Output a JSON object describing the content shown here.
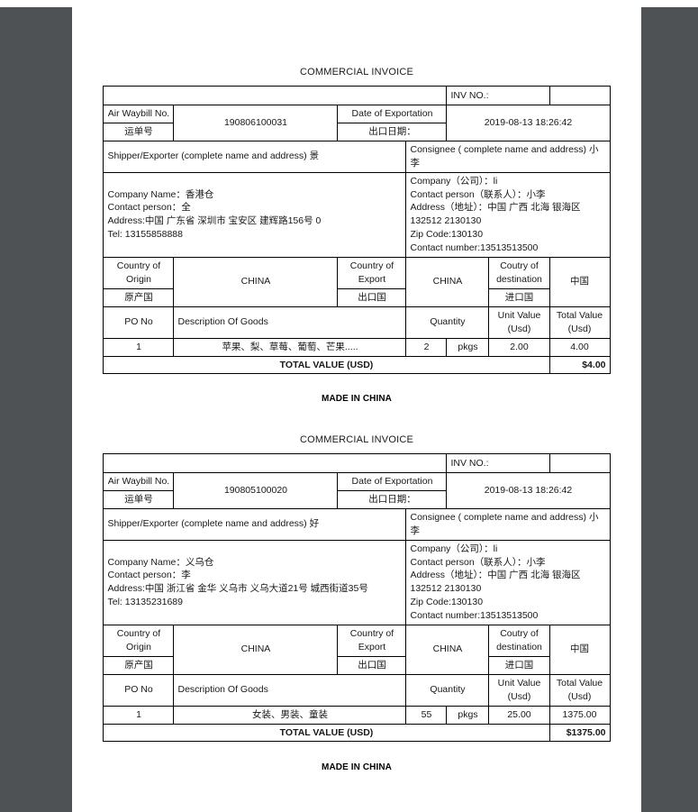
{
  "document": {
    "title": "COMMERCIAL INVOICE",
    "footer_note": "MADE IN CHINA",
    "page_background": "#4e5255",
    "paper_color": "#ffffff"
  },
  "labels": {
    "inv_no": "INV NO.:",
    "air_waybill_en": "Air Waybill No.",
    "air_waybill_cn": "运单号",
    "date_of_exportation_en": "Date of Exportation",
    "date_of_exportation_cn": "出口日期：",
    "shipper_header": "Shipper/Exporter (complete name and address)",
    "consignee_header": "Consignee ( complete name and address)",
    "country_of_origin_en": "Country of Origin",
    "country_of_origin_cn": "原产国",
    "country_of_export_en": "Country of Export",
    "country_of_export_cn": "出口国",
    "country_of_destination_en": "Coutry of destination",
    "country_of_destination_cn": "进口国",
    "po_no": "PO No",
    "description_of_goods": "Description Of Goods",
    "quantity": "Quantity",
    "unit_value": "Unit Value (Usd)",
    "total_value": "Total Value (Usd)",
    "total_value_row": "TOTAL VALUE (USD)"
  },
  "invoices": [
    {
      "id": "invoice-1",
      "inv_no_value": "",
      "air_waybill_no": "190806100031",
      "date_of_exportation": "2019-08-13 18:26:42",
      "shipper_suffix": "景",
      "consignee_suffix": "小李",
      "shipper": {
        "company_name": "Company Name：香港仓",
        "contact_person": "Contact person：全",
        "address": "Address:中国 广东省 深圳市 宝安区 建辉路156号 0",
        "tel": "Tel: 13155858888"
      },
      "consignee": {
        "company": "Company（公司）：li",
        "contact_person": "Contact person（联系人）：小李",
        "address": "Address（地址）：中国 广西 北海 银海区 132512 2130130",
        "zip_code": "Zip Code:130130",
        "contact_number": "Contact number:13513513500"
      },
      "origin_value": "CHINA",
      "export_value": "CHINA",
      "destination_value": "中国",
      "items": [
        {
          "po_no": "1",
          "description": "苹果、梨、草莓、葡萄、芒果.....",
          "quantity": "2",
          "unit": "pkgs",
          "unit_value": "2.00",
          "total_value": "4.00"
        }
      ],
      "grand_total": "$4.00"
    },
    {
      "id": "invoice-2",
      "inv_no_value": "",
      "air_waybill_no": "190805100020",
      "date_of_exportation": "2019-08-13 18:26:42",
      "shipper_suffix": "好",
      "consignee_suffix": "小李",
      "shipper": {
        "company_name": "Company Name：义乌仓",
        "contact_person": "Contact person：李",
        "address": "Address:中国 浙江省 金华 义乌市 义乌大道21号 城西街道35号",
        "tel": "Tel: 13135231689"
      },
      "consignee": {
        "company": "Company（公司）：li",
        "contact_person": "Contact person（联系人）：小李",
        "address": "Address（地址）：中国 广西 北海 银海区 132512 2130130",
        "zip_code": "Zip Code:130130",
        "contact_number": "Contact number:13513513500"
      },
      "origin_value": "CHINA",
      "export_value": "CHINA",
      "destination_value": "中国",
      "items": [
        {
          "po_no": "1",
          "description": "女装、男装、童装",
          "quantity": "55",
          "unit": "pkgs",
          "unit_value": "25.00",
          "total_value": "1375.00"
        }
      ],
      "grand_total": "$1375.00"
    }
  ]
}
